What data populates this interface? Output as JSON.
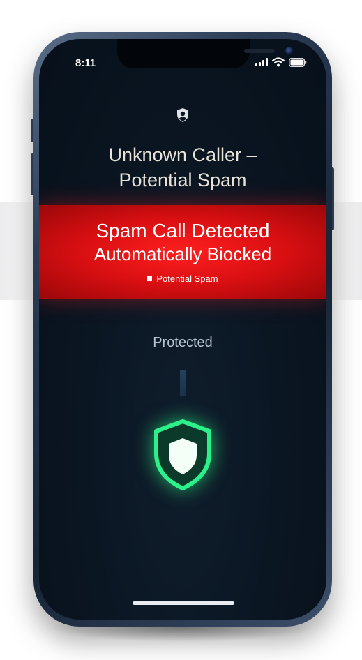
{
  "status_bar": {
    "time": "8:11"
  },
  "call": {
    "title_line1": "Unknown Caller –",
    "title_line2": "Potential Spam"
  },
  "alert": {
    "line1": "Spam Call Detected",
    "line2": "Automatically Biocked",
    "tag": "Potential Spam",
    "color": "#e01013"
  },
  "protection": {
    "label": "Protected",
    "shield_color": "#22e07a"
  },
  "icons": {
    "caller": "shield-person-icon",
    "signal": "signal-icon",
    "wifi": "wifi-icon",
    "battery": "battery-icon",
    "protected": "shield-check-icon"
  }
}
